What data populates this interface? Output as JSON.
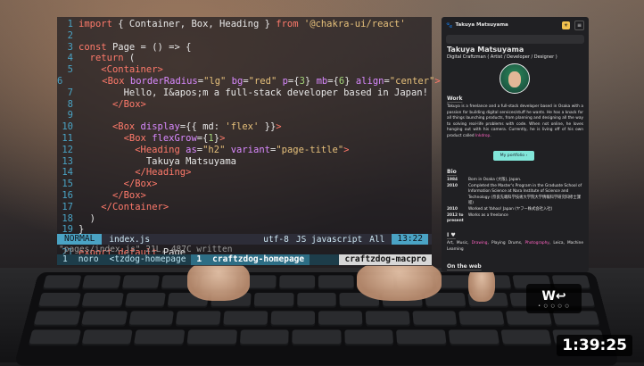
{
  "editor": {
    "lines": [
      {
        "n": "1",
        "tokens": [
          [
            "kw",
            "import "
          ],
          [
            "plain",
            "{ Container, Box, Heading } "
          ],
          [
            "kw",
            "from "
          ],
          [
            "str",
            "'@chakra-ui/react'"
          ]
        ]
      },
      {
        "n": "2",
        "tokens": []
      },
      {
        "n": "3",
        "tokens": [
          [
            "kw",
            "const "
          ],
          [
            "plain",
            "Page = () => {"
          ]
        ]
      },
      {
        "n": "4",
        "tokens": [
          [
            "plain",
            "  "
          ],
          [
            "kw",
            "return "
          ],
          [
            "plain",
            "("
          ]
        ]
      },
      {
        "n": "5",
        "tokens": [
          [
            "plain",
            "    "
          ],
          [
            "tag",
            "<Container>"
          ]
        ]
      },
      {
        "n": "6",
        "tokens": [
          [
            "plain",
            "      "
          ],
          [
            "tag",
            "<Box "
          ],
          [
            "attr",
            "borderRadius"
          ],
          [
            "plain",
            "="
          ],
          [
            "str",
            "\"lg\" "
          ],
          [
            "attr",
            "bg"
          ],
          [
            "plain",
            "="
          ],
          [
            "str",
            "\"red\" "
          ],
          [
            "attr",
            "p"
          ],
          [
            "plain",
            "={"
          ],
          [
            "num",
            "3"
          ],
          [
            "plain",
            "} "
          ],
          [
            "attr",
            "mb"
          ],
          [
            "plain",
            "={"
          ],
          [
            "num",
            "6"
          ],
          [
            "plain",
            "} "
          ],
          [
            "attr",
            "align"
          ],
          [
            "plain",
            "="
          ],
          [
            "str",
            "\"center\""
          ],
          [
            "tag",
            ">"
          ]
        ]
      },
      {
        "n": "7",
        "tokens": [
          [
            "plain",
            "        Hello, I&apos;m a full-stack developer based in Japan!"
          ]
        ]
      },
      {
        "n": "8",
        "tokens": [
          [
            "plain",
            "      "
          ],
          [
            "tag",
            "</Box>"
          ]
        ]
      },
      {
        "n": "9",
        "tokens": []
      },
      {
        "n": "10",
        "tokens": [
          [
            "plain",
            "      "
          ],
          [
            "tag",
            "<Box "
          ],
          [
            "attr",
            "display"
          ],
          [
            "plain",
            "={{ md: "
          ],
          [
            "str",
            "'flex'"
          ],
          [
            "plain",
            " }}"
          ],
          [
            "tag",
            ">"
          ]
        ]
      },
      {
        "n": "11",
        "tokens": [
          [
            "plain",
            "        "
          ],
          [
            "tag",
            "<Box "
          ],
          [
            "attr",
            "flexGrow"
          ],
          [
            "plain",
            "={"
          ],
          [
            "num",
            "1"
          ],
          [
            "plain",
            "}"
          ],
          [
            "tag",
            ">"
          ]
        ]
      },
      {
        "n": "12",
        "tokens": [
          [
            "plain",
            "          "
          ],
          [
            "tag",
            "<Heading "
          ],
          [
            "attr",
            "as"
          ],
          [
            "plain",
            "="
          ],
          [
            "str",
            "\"h2\" "
          ],
          [
            "attr",
            "variant"
          ],
          [
            "plain",
            "="
          ],
          [
            "str",
            "\"page-title\""
          ],
          [
            "tag",
            ">"
          ]
        ]
      },
      {
        "n": "13",
        "tokens": [
          [
            "plain",
            "            Takuya Matsuyama"
          ]
        ]
      },
      {
        "n": "14",
        "tokens": [
          [
            "plain",
            "          "
          ],
          [
            "tag",
            "</Heading>"
          ]
        ]
      },
      {
        "n": "15",
        "tokens": [
          [
            "plain",
            "        "
          ],
          [
            "tag",
            "</Box>"
          ]
        ]
      },
      {
        "n": "16",
        "tokens": [
          [
            "plain",
            "      "
          ],
          [
            "tag",
            "</Box>"
          ]
        ]
      },
      {
        "n": "17",
        "tokens": [
          [
            "plain",
            "    "
          ],
          [
            "tag",
            "</Container>"
          ]
        ]
      },
      {
        "n": "18",
        "tokens": [
          [
            "plain",
            "  )"
          ]
        ]
      },
      {
        "n": "19",
        "tokens": [
          [
            "plain",
            "}"
          ]
        ]
      },
      {
        "n": "20",
        "tokens": []
      },
      {
        "n": "21",
        "tokens": [
          [
            "kw",
            "export default "
          ],
          [
            "plain",
            "Page"
          ]
        ]
      }
    ],
    "status": {
      "mode": "NORMAL",
      "file": "index.js",
      "encoding": "utf-8",
      "filetype": "JS javascript",
      "scroll": "All",
      "position": "13:22"
    },
    "message": "\"pages/index.js\" 21L, 487C written",
    "tmux": {
      "session_num": "1",
      "shell": "noro",
      "window_inactive": "<tzdog-homepage",
      "window_active_num": "1",
      "window_active": "craftzdog-homepage",
      "host": "craftzdog-macpro"
    }
  },
  "site": {
    "brand": "Takuya Matsuyama",
    "theme_icon": "sun-icon",
    "name": "Takuya Matsuyama",
    "subtitle": "Digital Craftzman ( Artist / Developer / Designer )",
    "work_heading": "Work",
    "work_text_1": "Takuya is a freelance and a full-stack developer based in Osaka with a passion for building digital services/stuff he wants. He has a knack for all things launching products, from planning and designing all the way to solving real-life problems with code. When not online, he loves hanging out with his camera. Currently, he is living off of his own product called ",
    "work_link": "Inkdrop",
    "work_text_2": ".",
    "portfolio_button": "My portfolio",
    "bio_heading": "Bio",
    "bio": [
      {
        "year": "1984",
        "text": "Born in Osaka (大阪), Japan."
      },
      {
        "year": "2010",
        "text": "Completed the Master's Program in the Graduate School of Information Science at Nara Institute of Science and Technology (奈良先端科学技術大学院大学情報科学研究科修士課程)"
      },
      {
        "year": "2010",
        "text": "Worked at Yahoo! Japan (ヤフー株式会社入社)"
      },
      {
        "year": "2012 to present",
        "text": "Works as a freelance"
      }
    ],
    "love_heading": "I ♥",
    "love_text_1": "Art, Music, ",
    "love_link_1": "Drawing",
    "love_text_2": ", Playing Drums, ",
    "love_link_2": "Photography",
    "love_text_3": ", Leica, Machine Learning",
    "web_heading": "On the web"
  },
  "overlay": {
    "key_top": "W↩",
    "key_bottom": "• ○ ○ ○ ○",
    "duration": "1:39:25"
  },
  "colors": {
    "accent_teal": "#81e6d9",
    "link_pink": "#ff63c3",
    "vim_blue": "#4aa3c4"
  }
}
